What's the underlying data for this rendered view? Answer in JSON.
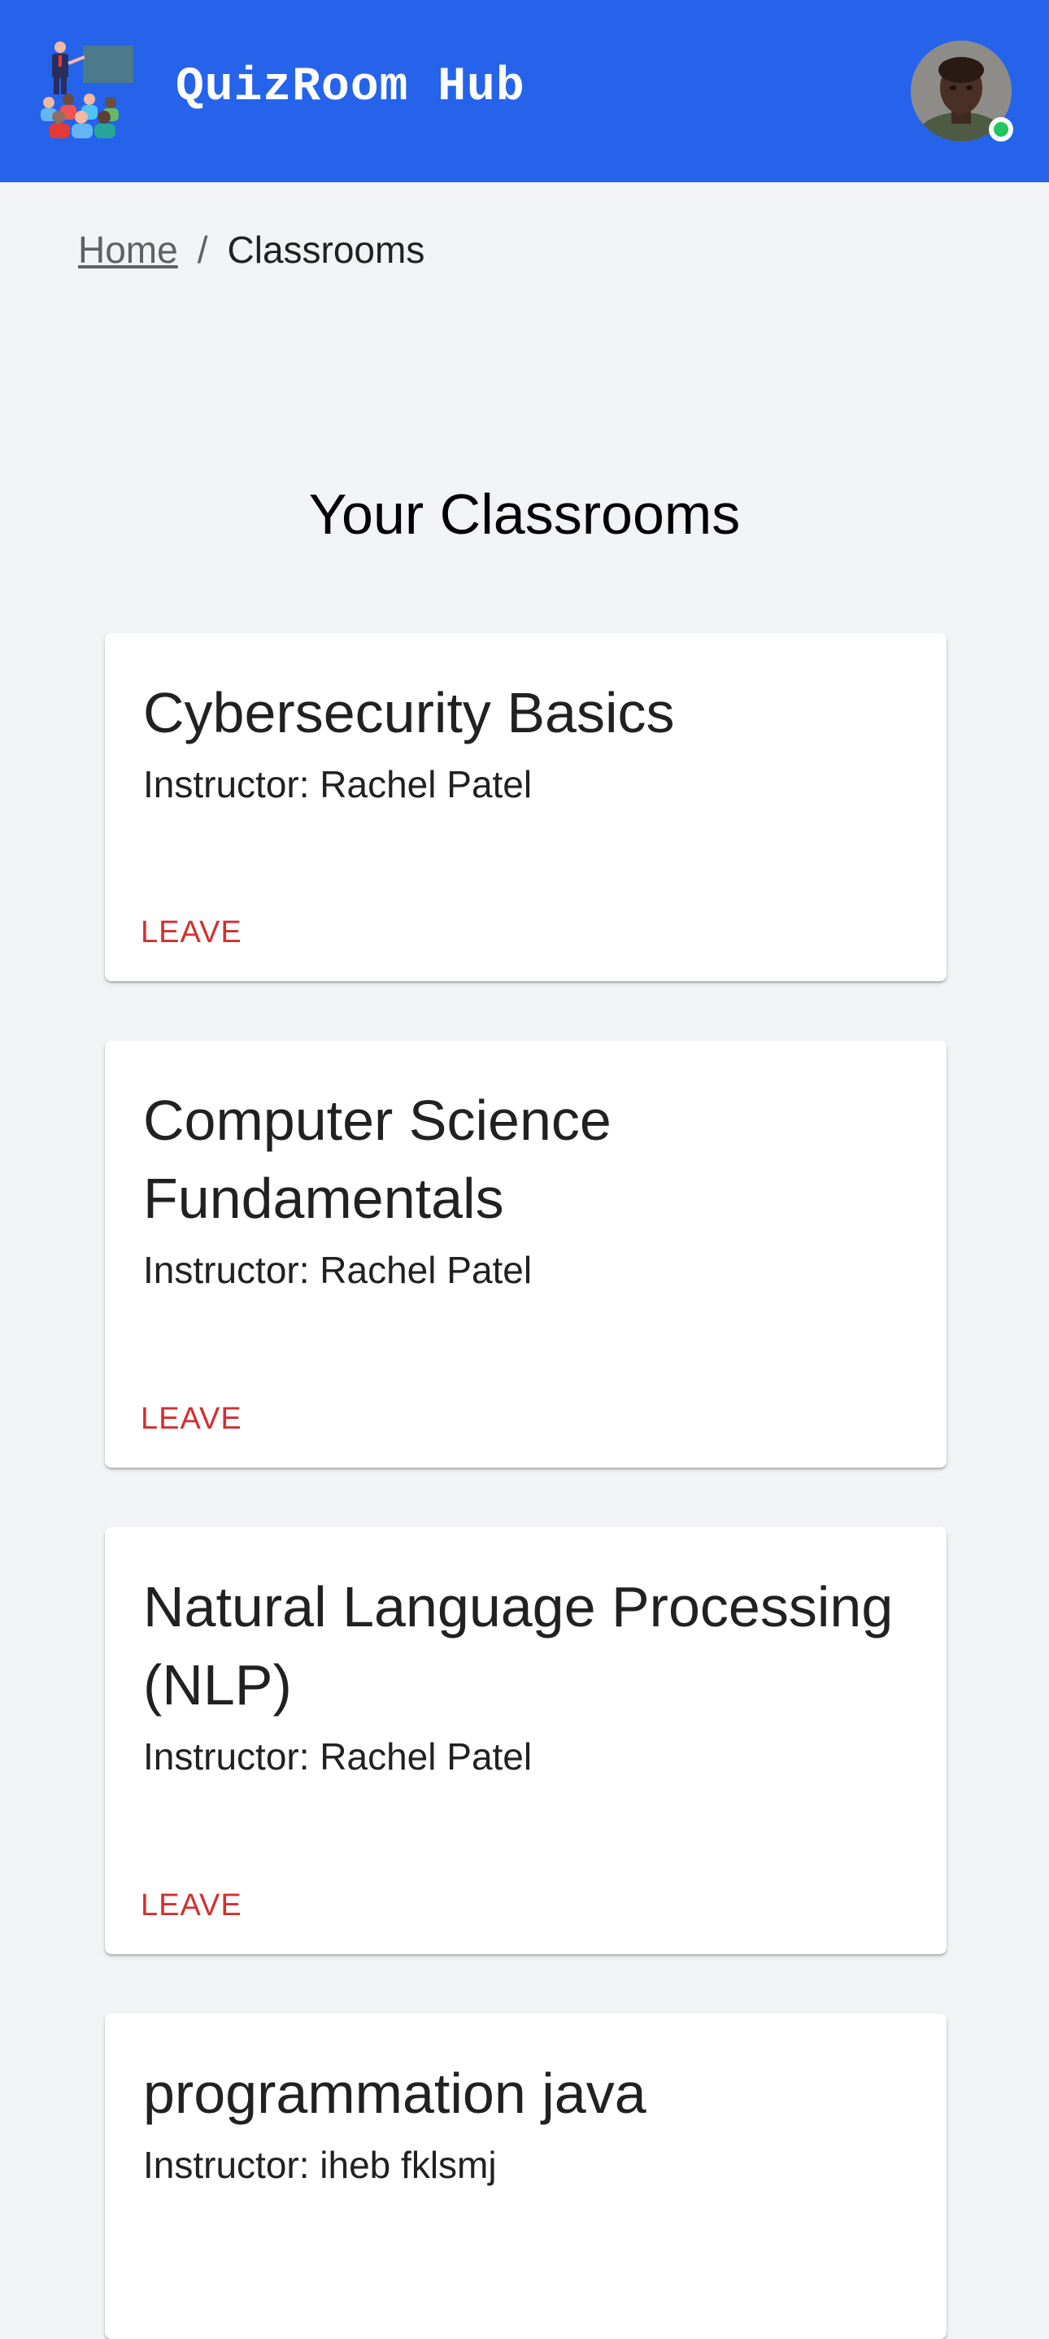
{
  "header": {
    "app_title": "QuizRoom Hub",
    "logo_icon": "classroom-teacher-icon",
    "avatar": "user-avatar",
    "status": "online",
    "colors": {
      "bar": "#2563eb",
      "status": "#22c55e"
    }
  },
  "breadcrumb": {
    "home": "Home",
    "separator": "/",
    "current": "Classrooms"
  },
  "main": {
    "heading": "Your Classrooms",
    "classrooms": [
      {
        "title": "Cybersecurity Basics",
        "instructor": "Instructor: Rachel Patel",
        "action": "LEAVE"
      },
      {
        "title": "Computer Science Fundamentals",
        "instructor": "Instructor: Rachel Patel",
        "action": "LEAVE"
      },
      {
        "title": "Natural Language Processing (NLP)",
        "instructor": "Instructor: Rachel Patel",
        "action": "LEAVE"
      },
      {
        "title": "programmation java",
        "instructor": "Instructor: iheb fklsmj"
      }
    ],
    "colors": {
      "leave": "#d32f2f",
      "background": "#f2f3f5"
    }
  }
}
